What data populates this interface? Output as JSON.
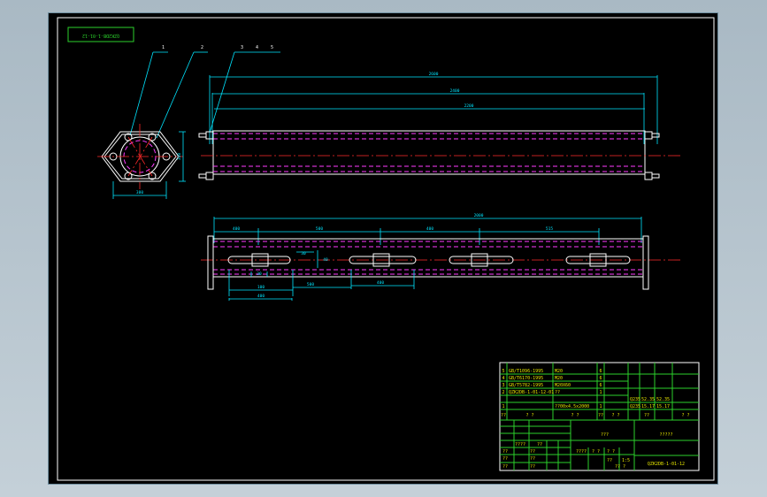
{
  "drawing": {
    "stamp_text": "QZK2DB-1-01-12",
    "balloons": [
      "1",
      "2",
      "3",
      "4",
      "5"
    ],
    "end_view_dims": {
      "width": "380",
      "height": "380"
    },
    "top_view_dims": {
      "overall": "2600",
      "inner": "2400",
      "tube": "2200"
    },
    "bottom_view_dims": {
      "total": "2000",
      "segments": [
        "400",
        "500",
        "400",
        "515"
      ],
      "sub_dims": [
        "100",
        "400",
        "500",
        "400",
        "30",
        "30",
        "40"
      ]
    },
    "title_block": {
      "parts": [
        {
          "no": "5",
          "code": "GB/T1096-1995",
          "name": "M20",
          "qty": "6",
          "material": "",
          "weight": "",
          "total": ""
        },
        {
          "no": "4",
          "code": "GB/T6170-1995",
          "name": "M20",
          "qty": "6",
          "material": "",
          "weight": "",
          "total": ""
        },
        {
          "no": "3",
          "code": "GB/T5782-1995",
          "name": "M20X60",
          "qty": "6",
          "material": "",
          "weight": "",
          "total": ""
        },
        {
          "no": "2",
          "code": "QZK2DB-1-01-12-01",
          "name": "??",
          "qty": "1",
          "material": "Q235",
          "weight": "52.35",
          "total": "52.35"
        },
        {
          "no": "1",
          "code": "",
          "name": "??00x4.5x2000",
          "qty": "1",
          "material": "Q235",
          "weight": "15.17",
          "total": "15.17"
        }
      ],
      "header_row": [
        "??",
        "? ?",
        "? ?",
        "??",
        "? ?",
        "??",
        "? ?"
      ],
      "totals_row": [
        "? ?",
        "? ?"
      ],
      "drawing_name": "?????",
      "drawing_code": "QZK2DB-1-01-12",
      "sign_cells": [
        "????",
        "??",
        "??",
        "??",
        "??",
        "??",
        "??",
        "??"
      ],
      "scale_cells": [
        "????",
        "? ?",
        "? ?",
        "??",
        "1:5"
      ],
      "weight_label": "???",
      "sheet": "?? ?"
    }
  }
}
